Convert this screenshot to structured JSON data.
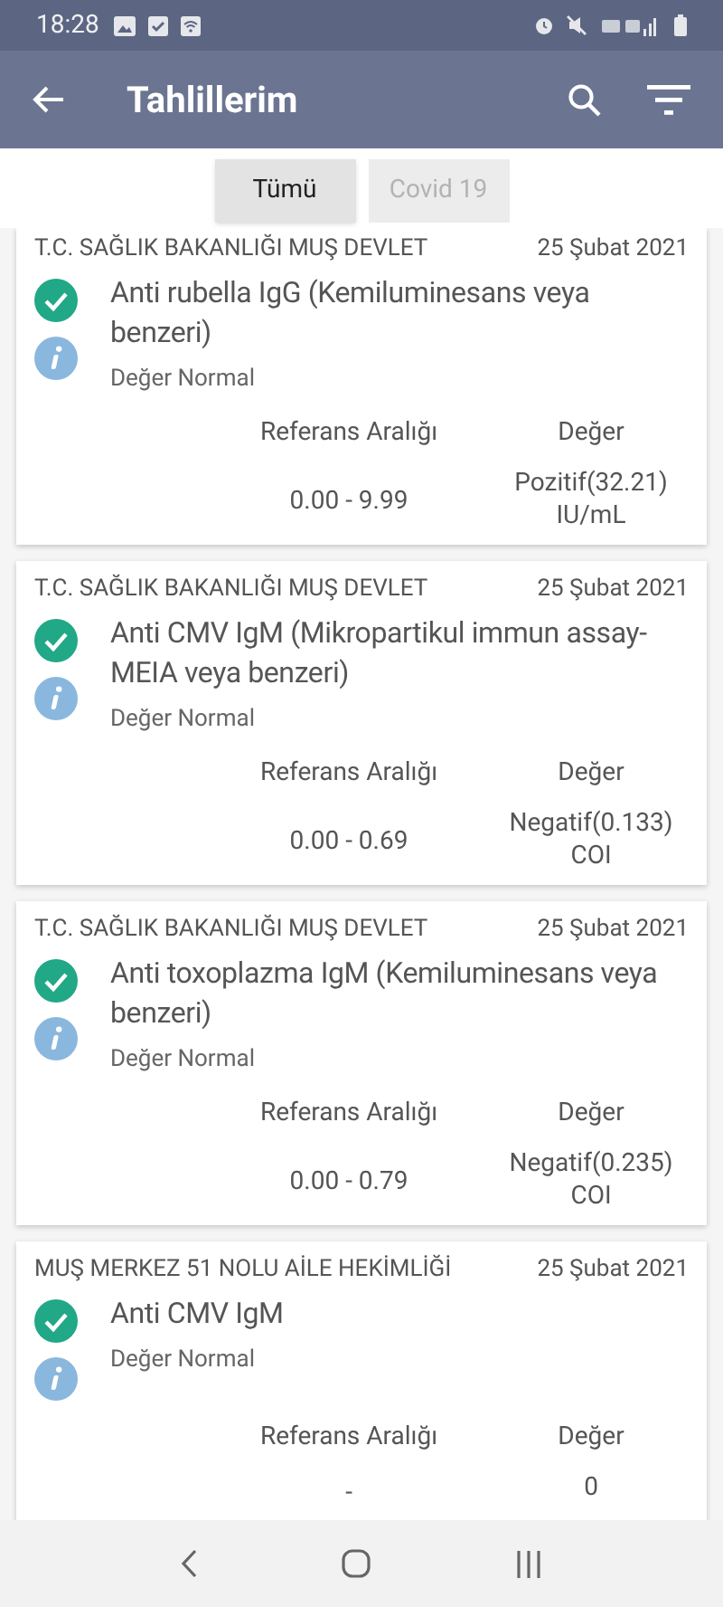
{
  "status_bar": {
    "time": "18:28"
  },
  "app_bar": {
    "title": "Tahlillerim"
  },
  "tabs": [
    {
      "label": "Tümü",
      "selected": true
    },
    {
      "label": "Covid 19",
      "selected": false
    }
  ],
  "results": [
    {
      "institution": "T.C. SAĞLIK BAKANLIĞI MUŞ DEVLET",
      "date": "25 Şubat 2021",
      "test": "Anti rubella IgG (Kemiluminesans veya benzeri)",
      "status": "Değer Normal",
      "range_label": "Referans Aralığı",
      "value_label": "Değer",
      "range": "0.00 - 9.99",
      "value": "Pozitif(32.21)\nIU/mL"
    },
    {
      "institution": "T.C. SAĞLIK BAKANLIĞI MUŞ DEVLET",
      "date": "25 Şubat 2021",
      "test": "Anti CMV IgM (Mikropartikul immun assay-MEIA veya benzeri)",
      "status": "Değer Normal",
      "range_label": "Referans Aralığı",
      "value_label": "Değer",
      "range": "0.00 - 0.69",
      "value": "Negatif(0.133)\nCOI"
    },
    {
      "institution": "T.C. SAĞLIK BAKANLIĞI MUŞ DEVLET",
      "date": "25 Şubat 2021",
      "test": "Anti toxoplazma IgM (Kemiluminesans veya benzeri)",
      "status": "Değer Normal",
      "range_label": "Referans Aralığı",
      "value_label": "Değer",
      "range": "0.00 - 0.79",
      "value": "Negatif(0.235)\nCOI"
    },
    {
      "institution": "MUŞ MERKEZ 51 NOLU AİLE HEKİMLİĞİ",
      "date": "25 Şubat 2021",
      "test": "Anti CMV IgM",
      "status": "Değer Normal",
      "range_label": "Referans Aralığı",
      "value_label": "Değer",
      "range": "-",
      "value": "0"
    }
  ]
}
